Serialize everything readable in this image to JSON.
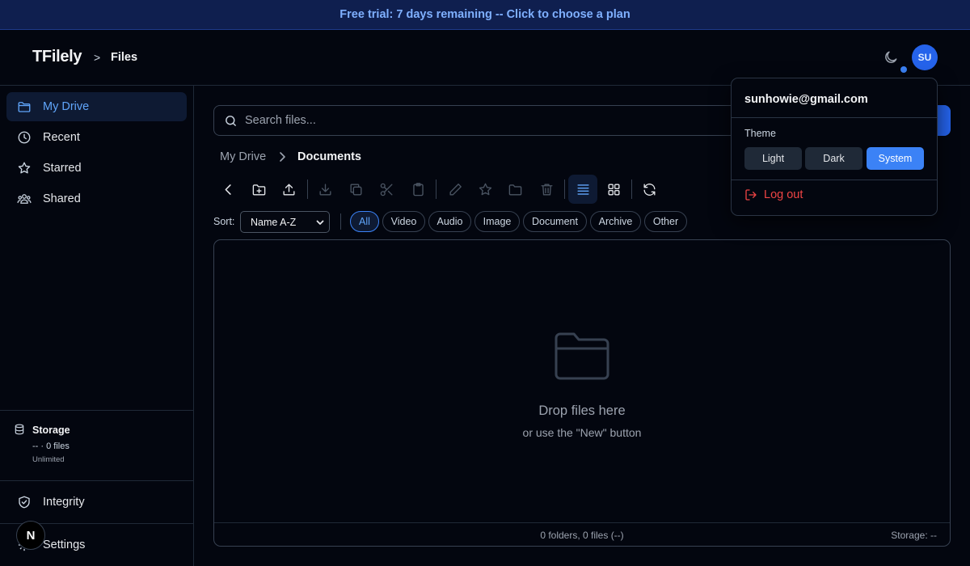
{
  "banner": {
    "text": "Free trial: 7 days remaining -- Click to choose a plan"
  },
  "header": {
    "brand": "TFilely",
    "separator": ">",
    "page": "Files",
    "avatar_initials": "SU",
    "theme_icon": "moon-icon"
  },
  "sidebar": {
    "items": [
      {
        "label": "My Drive",
        "icon": "folder-icon",
        "active": true
      },
      {
        "label": "Recent",
        "icon": "clock-icon",
        "active": false
      },
      {
        "label": "Starred",
        "icon": "star-icon",
        "active": false
      },
      {
        "label": "Shared",
        "icon": "users-icon",
        "active": false
      }
    ],
    "storage": {
      "title": "Storage",
      "value": "-- · 0 files",
      "limit": "Unlimited"
    },
    "bottom_items": [
      {
        "label": "Integrity",
        "icon": "shield-check-icon"
      },
      {
        "label": "Settings",
        "icon": "gear-icon"
      }
    ],
    "dev_badge": "N"
  },
  "search": {
    "placeholder": "Search files..."
  },
  "breadcrumb": {
    "root": "My Drive",
    "current": "Documents"
  },
  "toolbar": {
    "tools": [
      "back-icon",
      "new-folder-icon",
      "upload-icon",
      "download-icon",
      "copy-icon",
      "cut-icon",
      "paste-icon",
      "rename-icon",
      "star-icon",
      "move-icon",
      "delete-icon",
      "list-view-icon",
      "grid-view-icon",
      "refresh-icon"
    ],
    "active_view": "list"
  },
  "sort": {
    "label": "Sort:",
    "selected": "Name A-Z"
  },
  "filters": [
    {
      "label": "All",
      "active": true
    },
    {
      "label": "Video",
      "active": false
    },
    {
      "label": "Audio",
      "active": false
    },
    {
      "label": "Image",
      "active": false
    },
    {
      "label": "Document",
      "active": false
    },
    {
      "label": "Archive",
      "active": false
    },
    {
      "label": "Other",
      "active": false
    }
  ],
  "dropzone": {
    "title": "Drop files here",
    "subtitle": "or use the \"New\" button",
    "status_counts": "0 folders, 0 files (--)",
    "status_storage": "Storage: --"
  },
  "user_menu": {
    "email": "sunhowie@gmail.com",
    "theme_label": "Theme",
    "theme_options": [
      {
        "label": "Light",
        "active": false
      },
      {
        "label": "Dark",
        "active": false
      },
      {
        "label": "System",
        "active": true
      }
    ],
    "logout_label": "Log out"
  },
  "colors": {
    "background": "#03060f",
    "accent": "#3b82f6",
    "banner_bg": "#0f1f4f",
    "danger": "#ef4444"
  }
}
